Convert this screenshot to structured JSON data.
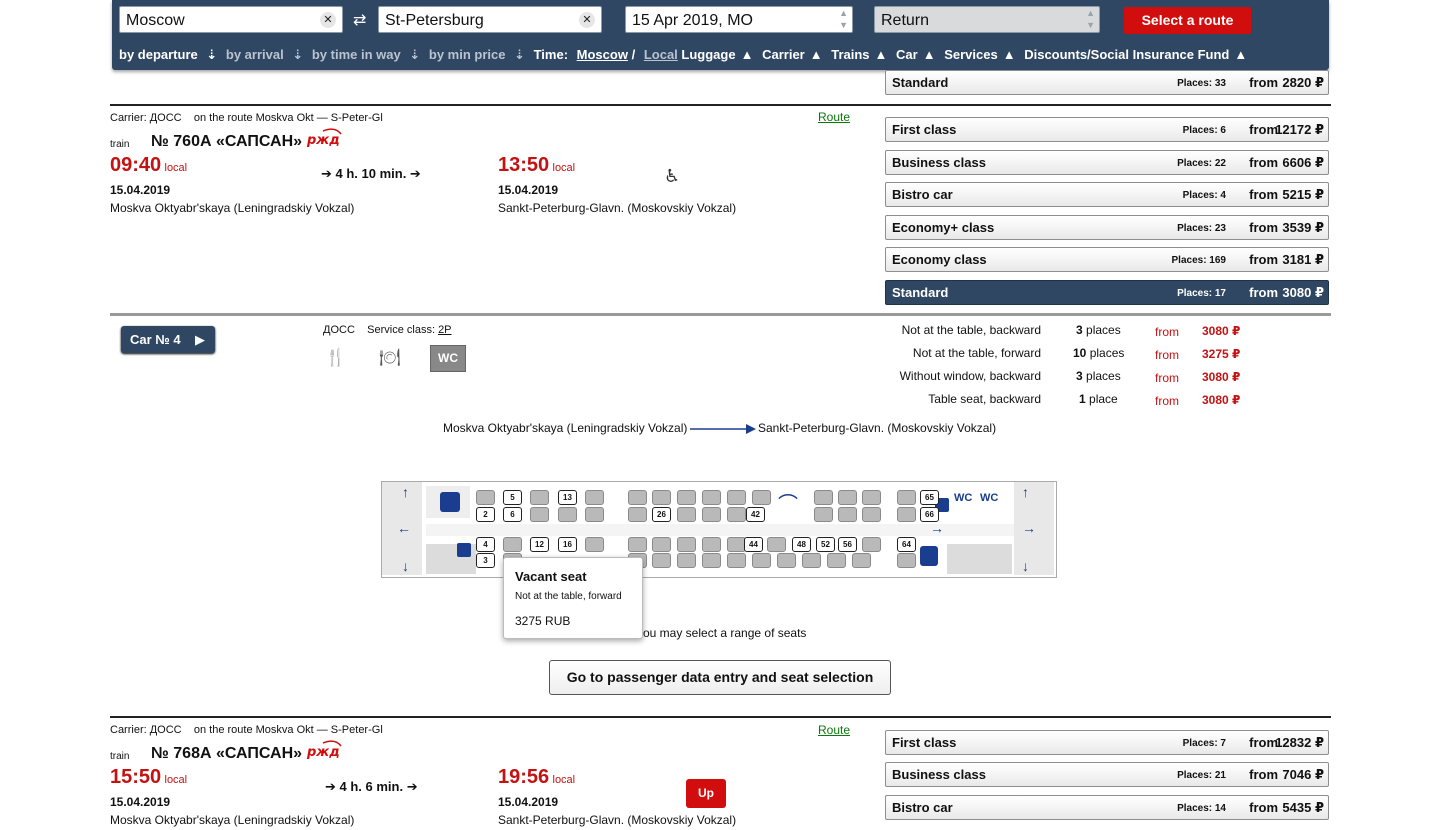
{
  "search": {
    "from": "Moscow",
    "to": "St-Petersburg",
    "date": "15 Apr 2019, MO",
    "return": "Return",
    "select_btn": "Select a route"
  },
  "sort": {
    "by_departure": "by departure",
    "by_arrival": "by arrival",
    "by_time_in_way": "by time in way",
    "by_min_price": "by min price",
    "time_label": "Time:",
    "time_moscow": "Moscow",
    "time_sep": "/",
    "time_local": "Local",
    "luggage": "Luggage",
    "carrier": "Carrier",
    "trains": "Trains",
    "car": "Car",
    "services": "Services",
    "discounts": "Discounts/Social Insurance Fund"
  },
  "prev_standard": {
    "name": "Standard",
    "places": "Places: 33",
    "from": "from",
    "price": "2820 ₽"
  },
  "train1": {
    "carrier": "Carrier: ДОСС",
    "route_text": "on the route Moskva Okt — S-Peter-Gl",
    "route_link": "Route",
    "train_label": "train",
    "number": "№ 760А «САПСАН»",
    "dep_time": "09:40",
    "arr_time": "13:50",
    "local": "local",
    "duration": "➔ 4 h. 10 min. ➔",
    "dep_date": "15.04.2019",
    "arr_date": "15.04.2019",
    "dep_station": "Moskva Oktyabr'skaya (Leningradskiy Vokzal)",
    "arr_station": "Sankt-Peterburg-Glavn. (Moskovskiy Vokzal)",
    "classes": [
      {
        "name": "First class",
        "places": "Places: 6",
        "from": "from",
        "price": "12172 ₽"
      },
      {
        "name": "Business class",
        "places": "Places: 22",
        "from": "from",
        "price": "6606 ₽"
      },
      {
        "name": "Bistro car",
        "places": "Places: 4",
        "from": "from",
        "price": "5215 ₽"
      },
      {
        "name": "Economy+ class",
        "places": "Places: 23",
        "from": "from",
        "price": "3539 ₽"
      },
      {
        "name": "Economy class",
        "places": "Places: 169",
        "from": "from",
        "price": "3181 ₽"
      },
      {
        "name": "Standard",
        "places": "Places: 17",
        "from": "from",
        "price": "3080 ₽"
      }
    ]
  },
  "car": {
    "button": "Car  № 4",
    "carrier": "ДОСС",
    "service_label": "Service class:",
    "service_class": "2Р",
    "wc": "WC",
    "seat_types": [
      {
        "label": "Not at the table, backward",
        "count": "3",
        "unit": "places",
        "from": "from",
        "price": "3080 ₽"
      },
      {
        "label": "Not at the table, forward",
        "count": "10",
        "unit": "places",
        "from": "from",
        "price": "3275 ₽"
      },
      {
        "label": "Without window, backward",
        "count": "3",
        "unit": "places",
        "from": "from",
        "price": "3080 ₽"
      },
      {
        "label": "Table seat, backward",
        "count": "1",
        "unit": "place",
        "from": "from",
        "price": "3080 ₽"
      }
    ],
    "direction_from": "Moskva Oktyabr'skaya (Leningradskiy Vokzal)",
    "direction_to": "Sankt-Peterburg-Glavn. (Moskovskiy Vokzal)",
    "seats_top": [
      "5",
      "13",
      "65"
    ],
    "seats_mid": [
      "2",
      "6",
      "26",
      "42",
      "66"
    ],
    "seats_low": [
      "4",
      "12",
      "16",
      "44",
      "48",
      "52",
      "56",
      "64"
    ],
    "seats_bottom": [
      "3"
    ],
    "tooltip_title": "Vacant seat",
    "tooltip_desc": "Not at the table, forward",
    "tooltip_price": "3275 RUB",
    "range_hint": "ou may select a range of seats",
    "go_button": "Go to passenger data entry and seat selection"
  },
  "train2": {
    "carrier": "Carrier: ДОСС",
    "route_text": "on the route Moskva Okt — S-Peter-Gl",
    "route_link": "Route",
    "train_label": "train",
    "number": "№ 768А «САПСАН»",
    "dep_time": "15:50",
    "arr_time": "19:56",
    "local": "local",
    "duration": "➔ 4 h. 6 min. ➔",
    "dep_date": "15.04.2019",
    "arr_date": "15.04.2019",
    "dep_station": "Moskva Oktyabr'skaya (Leningradskiy Vokzal)",
    "arr_station": "Sankt-Peterburg-Glavn. (Moskovskiy Vokzal)",
    "up": "Up",
    "classes": [
      {
        "name": "First class",
        "places": "Places: 7",
        "from": "from",
        "price": "12832 ₽"
      },
      {
        "name": "Business class",
        "places": "Places: 21",
        "from": "from",
        "price": "7046 ₽"
      },
      {
        "name": "Bistro car",
        "places": "Places: 14",
        "from": "from",
        "price": "5435 ₽"
      }
    ]
  }
}
